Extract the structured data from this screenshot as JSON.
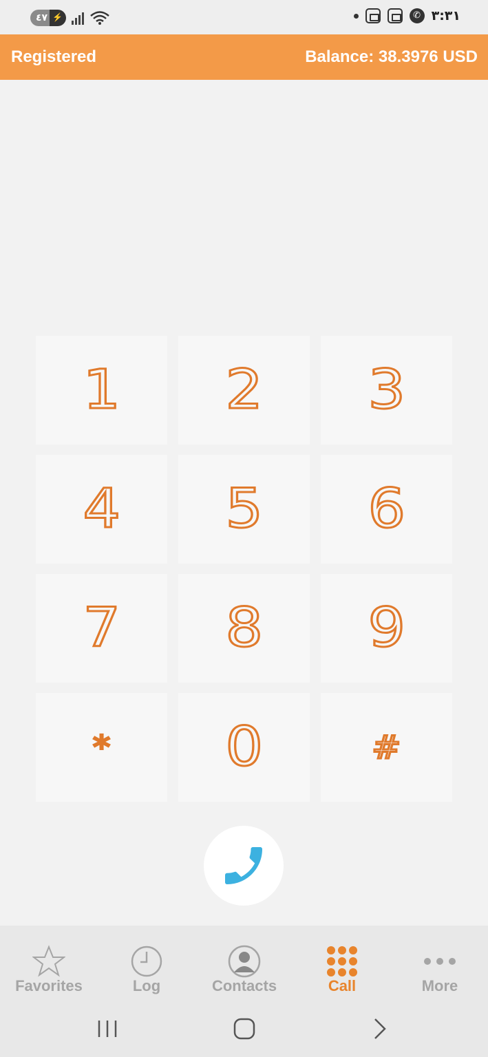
{
  "status_bar": {
    "battery": "٤٧",
    "time": "٣:٣١"
  },
  "header": {
    "status": "Registered",
    "balance": "Balance: 38.3976 USD"
  },
  "keypad": {
    "keys": [
      "1",
      "2",
      "3",
      "4",
      "5",
      "6",
      "7",
      "8",
      "9",
      "*",
      "0",
      "#"
    ]
  },
  "call_button": {
    "icon": "phone-icon",
    "color": "#3cb1e0"
  },
  "bottom_nav": {
    "tabs": [
      {
        "label": "Favorites",
        "icon": "star-icon"
      },
      {
        "label": "Log",
        "icon": "clock-icon"
      },
      {
        "label": "Contacts",
        "icon": "contact-icon"
      },
      {
        "label": "Call",
        "icon": "dialpad-icon",
        "active": true
      },
      {
        "label": "More",
        "icon": "more-icon"
      }
    ]
  },
  "colors": {
    "accent": "#f39a48",
    "key_text": "#e07a2c",
    "inactive_tab": "#a5a5a5",
    "active_tab": "#e8842c"
  }
}
